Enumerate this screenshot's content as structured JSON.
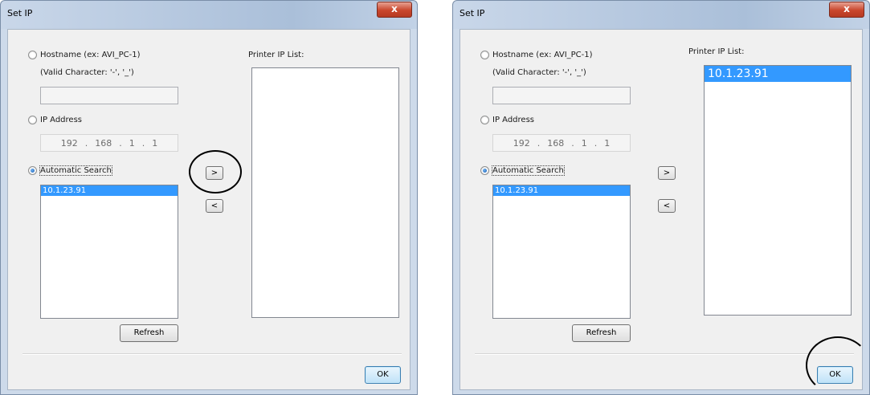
{
  "left_dialog": {
    "title": "Set IP",
    "close_label": "x",
    "hostname_label": "Hostname (ex: AVI_PC-1)",
    "valid_chars_label": "(Valid Character: '-', '_')",
    "hostname_value": "",
    "ip_label": "IP Address",
    "ip_octets": [
      "192",
      ".",
      "168",
      ".",
      "1",
      ".",
      "1"
    ],
    "auto_search_label": "Automatic Search",
    "search_results": [
      "10.1.23.91"
    ],
    "add_button": ">",
    "remove_button": "<",
    "refresh_button": "Refresh",
    "printer_list_label": "Printer IP List:",
    "printer_list": [],
    "ok_button": "OK"
  },
  "right_dialog": {
    "title": "Set IP",
    "close_label": "x",
    "hostname_label": "Hostname (ex: AVI_PC-1)",
    "valid_chars_label": "(Valid Character: '-', '_')",
    "hostname_value": "",
    "ip_label": "IP Address",
    "ip_octets": [
      "192",
      ".",
      "168",
      ".",
      "1",
      ".",
      "1"
    ],
    "auto_search_label": "Automatic Search",
    "search_results": [
      "10.1.23.91"
    ],
    "add_button": ">",
    "remove_button": "<",
    "refresh_button": "Refresh",
    "printer_list_label": "Printer IP List:",
    "printer_list": [
      "10.1.23.91"
    ],
    "ok_button": "OK"
  }
}
